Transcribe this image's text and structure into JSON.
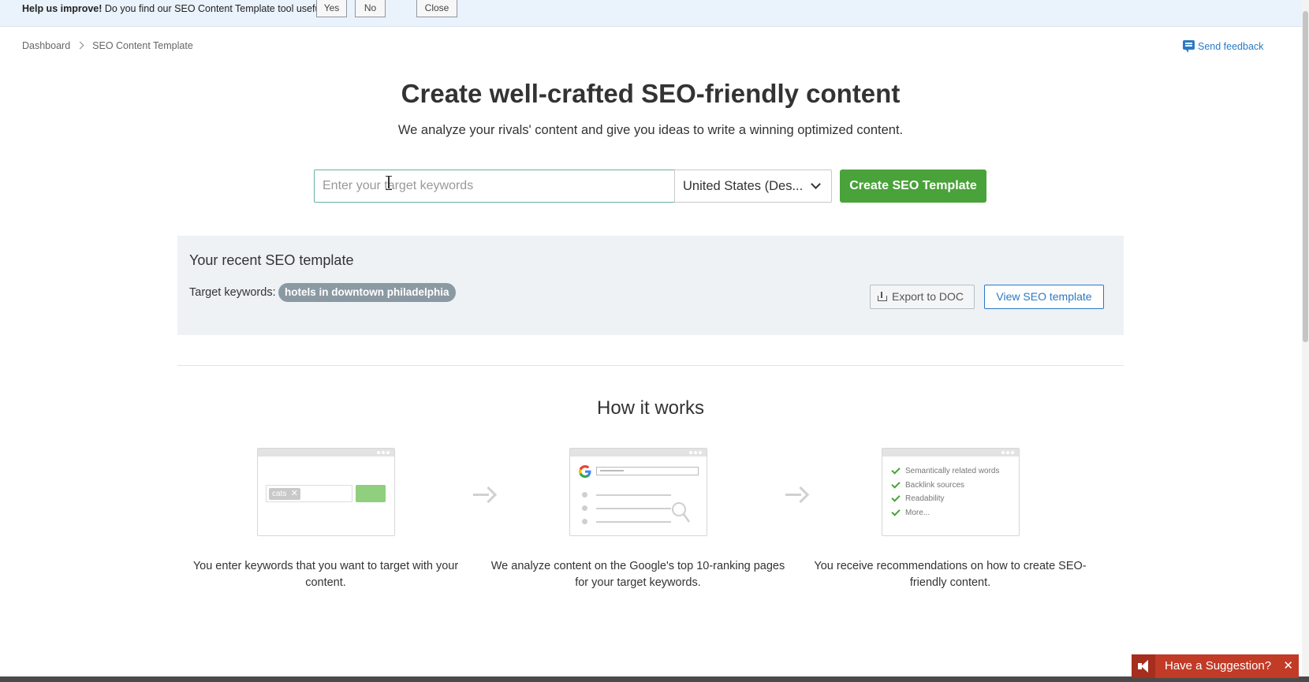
{
  "banner": {
    "lead": "Help us improve!",
    "question": " Do you find our SEO Content Template tool useful?",
    "yes_label": "Yes",
    "no_label": "No",
    "close_label": "Close"
  },
  "breadcrumb": {
    "items": [
      "Dashboard",
      "SEO Content Template"
    ]
  },
  "feedback": {
    "label": "Send feedback",
    "icon": "chat-icon"
  },
  "hero": {
    "title": "Create well-crafted SEO-friendly content",
    "subtitle": "We analyze your rivals' content and give you ideas to write a winning optimized content.",
    "keyword_placeholder": "Enter your target keywords",
    "keyword_value": "",
    "database_value": "United States (Des...",
    "create_button": "Create SEO Template"
  },
  "recent": {
    "title": "Your recent SEO template",
    "target_label": "Target keywords:",
    "keyword_chip": "hotels in downtown philadelphia",
    "export_button": "Export to DOC",
    "view_button": "View SEO template"
  },
  "how_it_works": {
    "title": "How it works",
    "steps": [
      {
        "illustration": "keyword-entry",
        "chip_text": "cats",
        "text": "You enter keywords that you want to target with your content."
      },
      {
        "illustration": "google-analysis",
        "text": "We analyze content on the Google's top 10-ranking pages for your target keywords."
      },
      {
        "illustration": "recommendations",
        "checklist": [
          "Semantically related words",
          "Backlink sources",
          "Readability",
          "More..."
        ],
        "text": "You receive recommendations on how to create SEO-friendly content."
      }
    ]
  },
  "suggestion_widget": {
    "label": "Have a Suggestion?",
    "close": "✕"
  },
  "colors": {
    "accent_green": "#4aa23a",
    "link_blue": "#2a7ac4",
    "banner_bg": "#eaf2fb",
    "panel_bg": "#eef2f5",
    "chip_gray": "#8b99a3",
    "suggest_red": "#c13b27"
  }
}
